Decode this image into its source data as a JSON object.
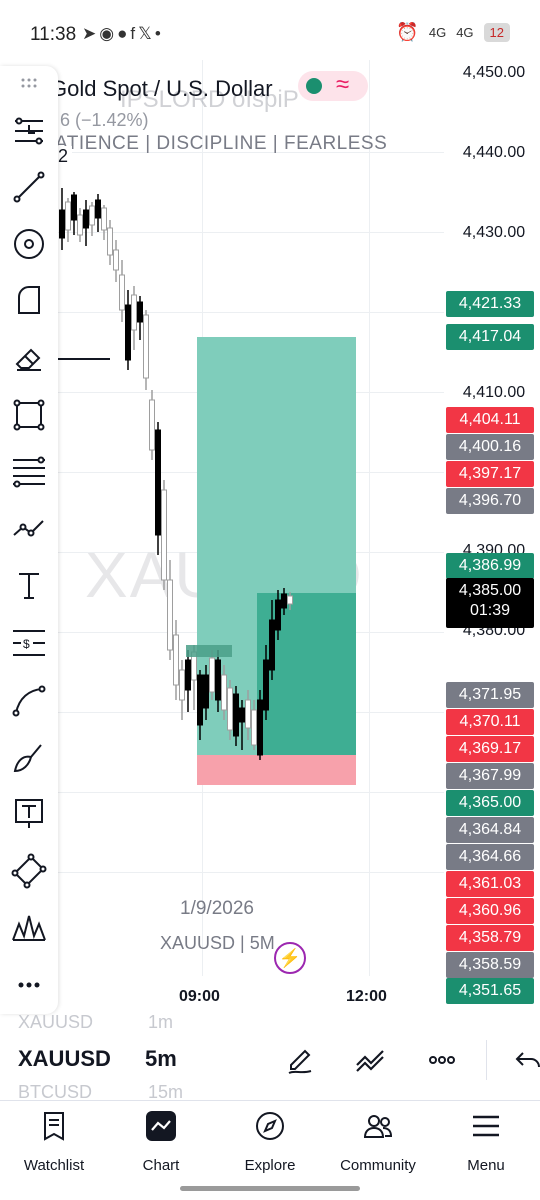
{
  "status_bar": {
    "time": "11:38",
    "notification_icons": [
      "telegram-icon",
      "discord-icon",
      "github-icon",
      "facebook-icon",
      "x-icon",
      "dot-icon"
    ],
    "signal_1": "4G",
    "signal_2": "4G",
    "battery": "12"
  },
  "chart": {
    "symbol_title": "Gold Spot / U.S. Dollar",
    "change_text": "6 (−1.42%)",
    "tagline": "ATIENCE  |  DISCIPLINE  |  FEARLESS",
    "ghost_overlay": "IPSLORD oIspiP",
    "badge": "2",
    "watermark": "XAUUSD",
    "date_label": "1/9/2026",
    "symbol_timeframe": "XAUUSD | 5M",
    "time_labels": [
      "09:00",
      "12:00"
    ],
    "axis_prices": [
      "4,450.00",
      "4,440.00",
      "4,430.00",
      "4,410.00",
      "4,390.00",
      "4,380.00"
    ],
    "price_tags": [
      {
        "text": "4,421.33",
        "color": "#1b8f6f"
      },
      {
        "text": "4,417.04",
        "color": "#1b8f6f"
      },
      {
        "text": "4,404.11",
        "color": "#f23645"
      },
      {
        "text": "4,400.16",
        "color": "#787b86"
      },
      {
        "text": "4,397.17",
        "color": "#f23645"
      },
      {
        "text": "4,396.70",
        "color": "#787b86"
      },
      {
        "text": "4,386.99",
        "color": "#1b8f6f"
      },
      {
        "text": "4,371.95",
        "color": "#787b86"
      },
      {
        "text": "4,370.11",
        "color": "#f23645"
      },
      {
        "text": "4,369.17",
        "color": "#f23645"
      },
      {
        "text": "4,367.99",
        "color": "#787b86"
      },
      {
        "text": "4,365.00",
        "color": "#1b8f6f"
      },
      {
        "text": "4,364.84",
        "color": "#787b86"
      },
      {
        "text": "4,364.66",
        "color": "#787b86"
      },
      {
        "text": "4,361.03",
        "color": "#f23645"
      },
      {
        "text": "4,360.96",
        "color": "#f23645"
      },
      {
        "text": "4,358.79",
        "color": "#f23645"
      },
      {
        "text": "4,358.59",
        "color": "#787b86"
      },
      {
        "text": "4,351.65",
        "color": "#1b8f6f"
      }
    ],
    "current_price": "4,385.00",
    "countdown": "01:39",
    "colors": {
      "up": "#1b8f6f",
      "down": "#f23645",
      "neutral": "#787b86",
      "target_zone": "#7fcdbb",
      "stop_zone": "#f7a1ab"
    }
  },
  "left_toolbar": {
    "tools": [
      "drag-handle-icon",
      "crosshair-menu-icon",
      "trend-line-icon",
      "circle-target-icon",
      "shape-icon",
      "eraser-icon",
      "rectangle-icon",
      "fib-lines-icon",
      "polyline-icon",
      "text-icon",
      "price-label-icon",
      "curve-icon",
      "brush-icon",
      "text-note-icon",
      "parallelogram-icon",
      "pattern-icon",
      "more-icon"
    ]
  },
  "bottom_bar": {
    "ghost_symbol_top": "XAUUSD",
    "ghost_tf_top": "1m",
    "symbol": "XAUUSD",
    "timeframe": "5m",
    "ghost_symbol_bottom": "BTCUSD",
    "ghost_tf_bottom": "15m"
  },
  "nav": {
    "items": [
      {
        "label": "Watchlist",
        "icon": "watchlist-icon"
      },
      {
        "label": "Chart",
        "icon": "chart-icon"
      },
      {
        "label": "Explore",
        "icon": "compass-icon"
      },
      {
        "label": "Community",
        "icon": "people-icon"
      },
      {
        "label": "Menu",
        "icon": "hamburger-icon"
      }
    ]
  }
}
